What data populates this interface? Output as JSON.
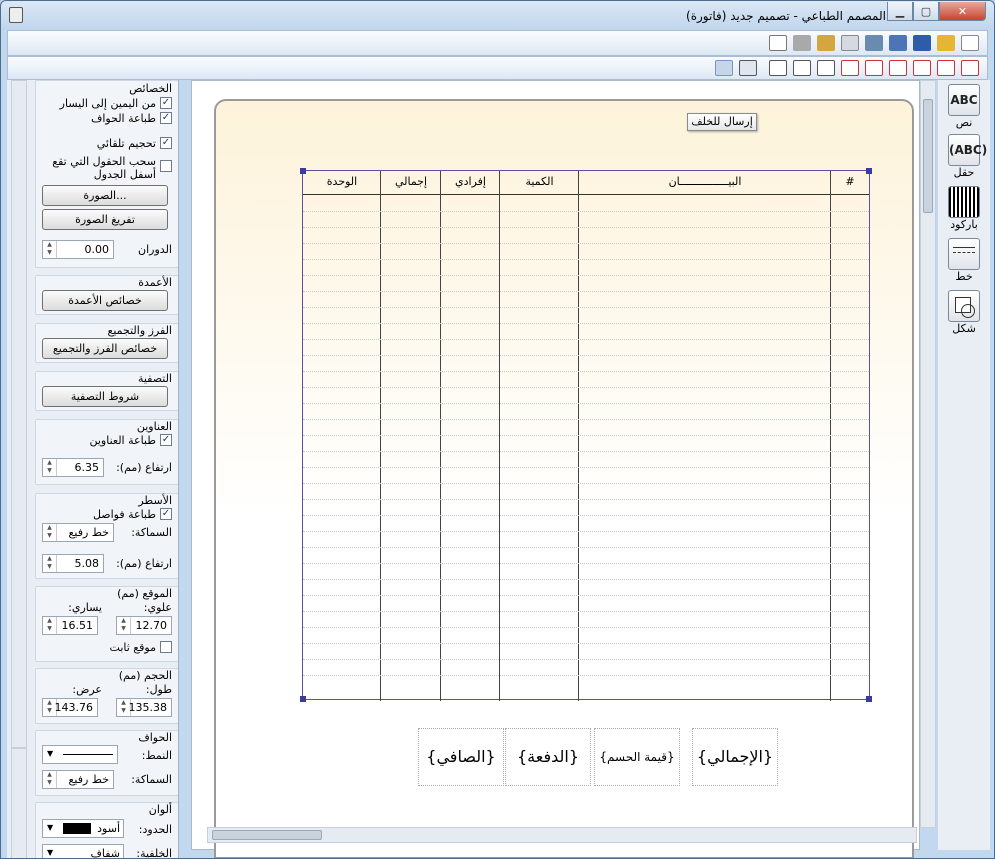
{
  "window": {
    "title": "المصمم الطباعي - تصميم جديد (فاتورة)"
  },
  "left": {
    "props_title": "الخصائص",
    "rtl": "من اليمين إلى اليسار",
    "print_borders": "طباعة الحواف",
    "auto_size": "تحجيم تلقائي",
    "pull_fields": "سحب الحقول التي تقع أسفل الجدول",
    "image_btn": "الصورة...",
    "clear_image_btn": "تفريغ الصورة",
    "rotation_label": "الدوران",
    "rotation": "0.00",
    "columns_title": "الأعمدة",
    "columns_btn": "خصائص الأعمدة",
    "sort_title": "الفرز والتجميع",
    "sort_btn": "خصائص الفرز والتجميع",
    "filter_title": "التصفية",
    "filter_btn": "شروط التصفية",
    "headers_title": "العناوين",
    "print_headers": "طباعة العناوين",
    "header_height_label": "ارتفاع (مم):",
    "header_height": "6.35",
    "rows_title": "الأسطر",
    "print_separators": "طباعة فواصل",
    "thickness_label": "السماكة:",
    "thickness": "خط رفيع",
    "row_height_label": "ارتفاع (مم):",
    "row_height": "5.08",
    "pos_title": "الموقع (مم)",
    "top_label": "علوي:",
    "left_label": "يساري:",
    "top": "12.70",
    "leftv": "16.51",
    "fixed_pos": "موقع ثابت",
    "size_title": "الحجم (مم)",
    "length_label": "طول:",
    "width_label": "عرض:",
    "length": "135.38",
    "width": "143.76",
    "borders_title": "الحواف",
    "style_label": "النمط:",
    "bthickness_label": "السماكة:",
    "bthickness": "خط رفيع",
    "colors_title": "ألوان",
    "border_color_label": "الحدود:",
    "border_color": "أسود",
    "bg_label": "الخلفية:",
    "bg": "شفاف"
  },
  "table": {
    "columns": [
      "#",
      "البيـــــــــــــــان",
      "الكمية",
      "إفرادي",
      "إجمالي",
      "الوحدة"
    ]
  },
  "canvas": {
    "tooltip": "إرسال للخلف",
    "fields": [
      "{الإجمالي}",
      "{قيمة الحسم}",
      "{الدفعة}",
      "{الصافي}"
    ]
  },
  "tools": [
    "نص",
    "حقل",
    "باركود",
    "خط",
    "شكل"
  ],
  "tool_icons": [
    "ABC",
    "(ABC)"
  ]
}
